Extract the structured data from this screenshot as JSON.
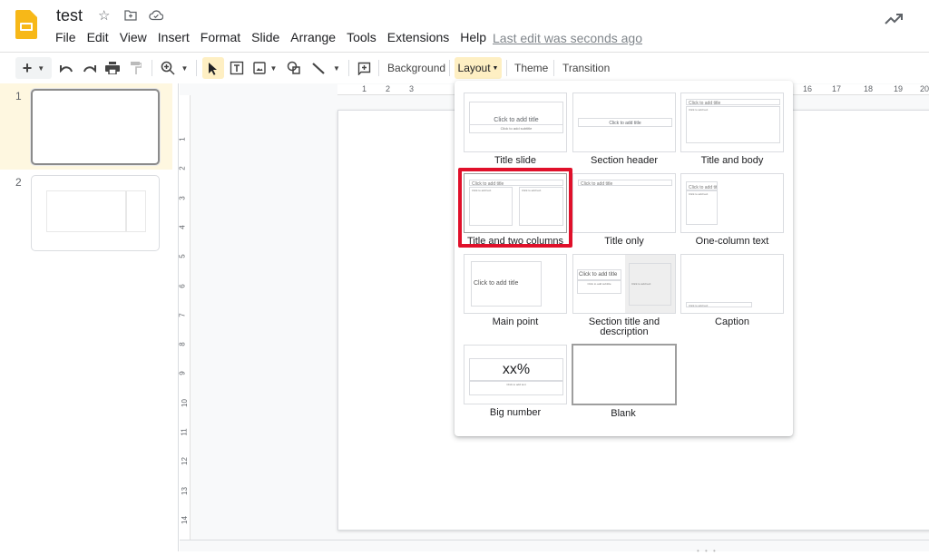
{
  "app": {
    "doc_title": "test",
    "title_icons": [
      "star-icon",
      "move-to-folder-icon",
      "cloud-saved-icon"
    ],
    "menu": [
      "File",
      "Edit",
      "View",
      "Insert",
      "Format",
      "Slide",
      "Arrange",
      "Tools",
      "Extensions",
      "Help"
    ],
    "last_edit": "Last edit was seconds ago",
    "activity_icon": "trending-up-icon"
  },
  "toolbar": {
    "background_label": "Background",
    "layout_label": "Layout",
    "theme_label": "Theme",
    "transition_label": "Transition"
  },
  "filmstrip": {
    "slides": [
      {
        "number": "1",
        "active": true
      },
      {
        "number": "2",
        "active": false
      }
    ]
  },
  "rulers": {
    "horizontal_visible": [
      "1",
      "2",
      "3",
      "16",
      "17",
      "18",
      "19",
      "20"
    ],
    "vertical": [
      "1",
      "2",
      "3",
      "4",
      "5",
      "6",
      "7",
      "8",
      "9",
      "10",
      "11",
      "12",
      "13",
      "14"
    ]
  },
  "layout_menu": {
    "highlight_color": "#e0102a",
    "items": [
      {
        "label": "Title slide",
        "title_ph": "Click to add title",
        "sub_ph": "Click to add subtitle"
      },
      {
        "label": "Section header",
        "title_ph": "Click to add title"
      },
      {
        "label": "Title and body",
        "title_ph": "Click to add title",
        "body_ph": "Click to add text"
      },
      {
        "label": "Title and two columns",
        "title_ph": "Click to add title",
        "body_ph": "Click to add text",
        "selected": true
      },
      {
        "label": "Title only",
        "title_ph": "Click to add title"
      },
      {
        "label": "One-column text",
        "title_ph": "Click to add title",
        "body_ph": "Click to add text"
      },
      {
        "label": "Main point",
        "title_ph": "Click to add title"
      },
      {
        "label": "Section title and description",
        "title_ph": "Click to add title",
        "sub_ph": "Click to add subtitle",
        "body_ph": "Click to add text"
      },
      {
        "label": "Caption",
        "body_ph": "Click to add text"
      },
      {
        "label": "Big number",
        "title_ph": "xx%",
        "body_ph": "Click to add text"
      },
      {
        "label": "Blank"
      }
    ]
  }
}
